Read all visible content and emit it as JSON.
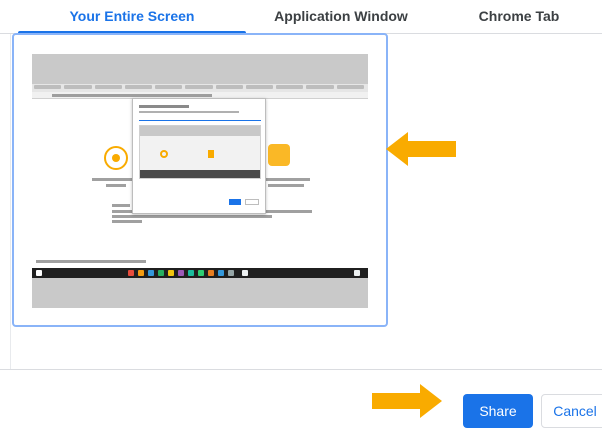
{
  "tabs": [
    {
      "label": "Your Entire Screen",
      "active": true
    },
    {
      "label": "Application Window",
      "active": false
    },
    {
      "label": "Chrome Tab",
      "active": false
    }
  ],
  "preview": {
    "description_icon": "screen-thumbnail"
  },
  "annotations": {
    "arrow_color": "#f9ab00"
  },
  "buttons": {
    "share_label": "Share",
    "cancel_label": "Cancel"
  },
  "colors": {
    "accent": "#1a73e8",
    "arrow": "#f9ab00"
  }
}
